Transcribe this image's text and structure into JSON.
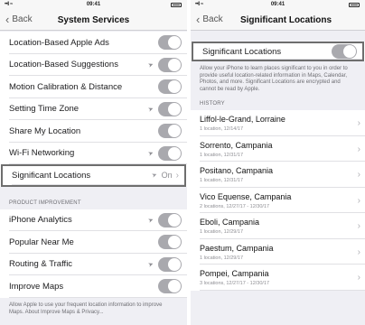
{
  "left": {
    "status": {
      "time": "09:41",
      "signal": "••ll ≈"
    },
    "nav": {
      "back": "Back",
      "title": "System Services"
    },
    "rows": [
      {
        "label": "Location-Based Apple Ads",
        "arrow": false
      },
      {
        "label": "Location-Based Suggestions",
        "arrow": true
      },
      {
        "label": "Motion Calibration & Distance",
        "arrow": false
      },
      {
        "label": "Setting Time Zone",
        "arrow": true
      },
      {
        "label": "Share My Location",
        "arrow": false
      },
      {
        "label": "Wi-Fi Networking",
        "arrow": true
      }
    ],
    "significant": {
      "label": "Significant Locations",
      "value": "On"
    },
    "section_header": "PRODUCT IMPROVEMENT",
    "improvement_rows": [
      {
        "label": "iPhone Analytics",
        "arrow": true
      },
      {
        "label": "Popular Near Me",
        "arrow": false
      },
      {
        "label": "Routing & Traffic",
        "arrow": true
      },
      {
        "label": "Improve Maps",
        "arrow": false
      }
    ],
    "footer": "Allow Apple to use your frequent location information to improve Maps. About Improve Maps & Privacy..."
  },
  "right": {
    "status": {
      "time": "09:41",
      "signal": "••ll ≈"
    },
    "nav": {
      "back": "Back",
      "title": "Significant Locations"
    },
    "toggle_label": "Significant Locations",
    "description": "Allow your iPhone to learn places significant to you in order to provide useful location-related information in Maps, Calendar, Photos, and more. Significant Locations are encrypted and cannot be read by Apple.",
    "history_header": "HISTORY",
    "history": [
      {
        "place": "Liffol-le-Grand, Lorraine",
        "detail": "1 location, 12/14/17"
      },
      {
        "place": "Sorrento, Campania",
        "detail": "1 location, 12/31/17"
      },
      {
        "place": "Positano, Campania",
        "detail": "1 location, 12/31/17"
      },
      {
        "place": "Vico Equense, Campania",
        "detail": "2 locations, 12/27/17 - 12/30/17"
      },
      {
        "place": "Eboli, Campania",
        "detail": "1 location, 12/29/17"
      },
      {
        "place": "Paestum, Campania",
        "detail": "1 location, 12/29/17"
      },
      {
        "place": "Pompei, Campania",
        "detail": "3 locations, 12/27/17 - 12/30/17"
      }
    ]
  }
}
